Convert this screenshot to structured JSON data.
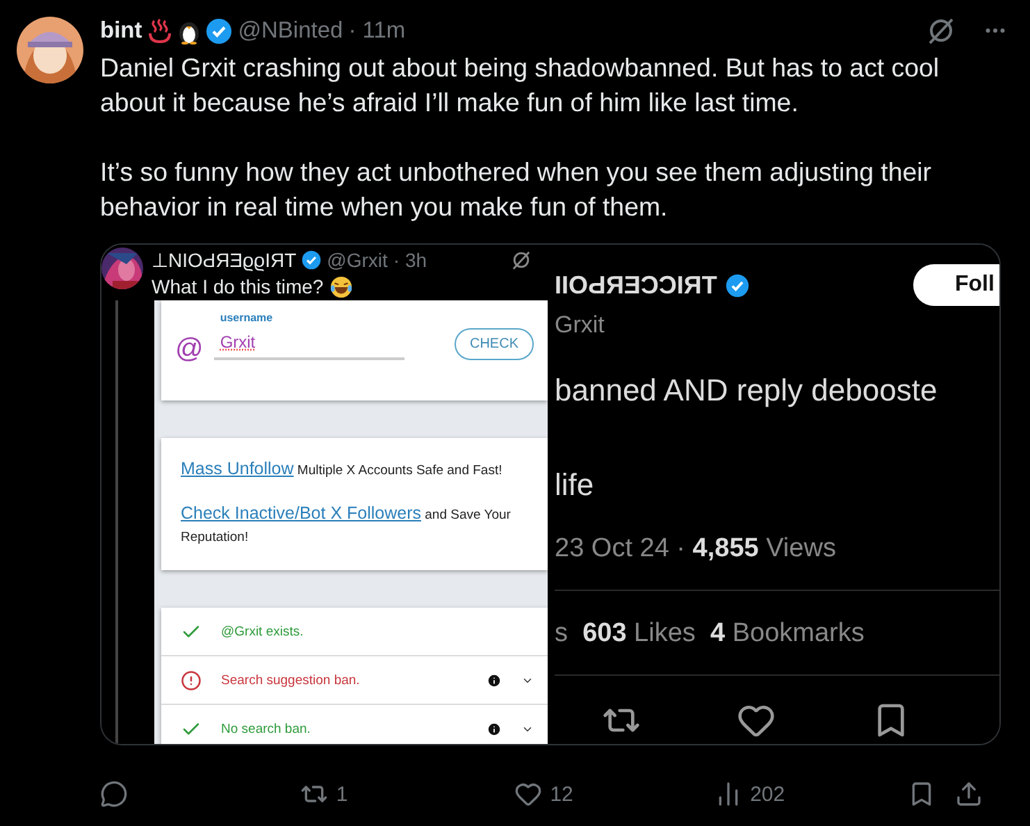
{
  "post": {
    "author": "bint",
    "verified": true,
    "handle": "@NBinted",
    "time": "· 11m",
    "paragraphs": [
      "Daniel Grxit crashing out about being shadowbanned. But has to act cool about it because he’s afraid I’ll make fun of him like last time.",
      "It’s so funny how they act unbothered when you see them adjusting their behavior in real time when you make fun of them."
    ]
  },
  "media": {
    "reply": {
      "name": "⊥NIOԀЯƎϱϱIЯT",
      "verified": true,
      "handle": "@Grxit",
      "time": "· 3h",
      "text": "What I do this time?"
    },
    "checker": {
      "field_label": "username",
      "at": "@",
      "value": "Grxit",
      "button": "CHECK"
    },
    "promo": [
      {
        "link": "Mass Unfollow",
        "text": " Multiple X Accounts Safe and Fast!"
      },
      {
        "link": "Check Inactive/Bot X Followers",
        "text": " and Save Your Reputation!"
      }
    ],
    "results": [
      {
        "kind": "ok",
        "text": "@Grxit exists.",
        "info": false
      },
      {
        "kind": "ban",
        "text": "Search suggestion ban.",
        "info": true
      },
      {
        "kind": "ok",
        "text": "No search ban.",
        "info": true
      }
    ],
    "detail": {
      "name": "IIOԀЯƎƆƆIЯT",
      "verified": true,
      "follow": "Foll",
      "handle": "Grxit",
      "lines": [
        "banned AND reply deboostе",
        "life"
      ],
      "meta": "23 Oct 24 · **4,855** Views",
      "stats": "s  **603** Likes  **4** Bookmarks",
      "actions": [
        {
          "kind": "retweet"
        },
        {
          "kind": "like"
        },
        {
          "kind": "bookmark"
        }
      ]
    }
  },
  "actions": [
    {
      "kind": "reply"
    },
    {
      "kind": "retweet",
      "count": "1"
    },
    {
      "kind": "like",
      "count": "12"
    },
    {
      "kind": "views",
      "count": "202"
    },
    {
      "kind": "bookmark"
    },
    {
      "kind": "share"
    }
  ]
}
